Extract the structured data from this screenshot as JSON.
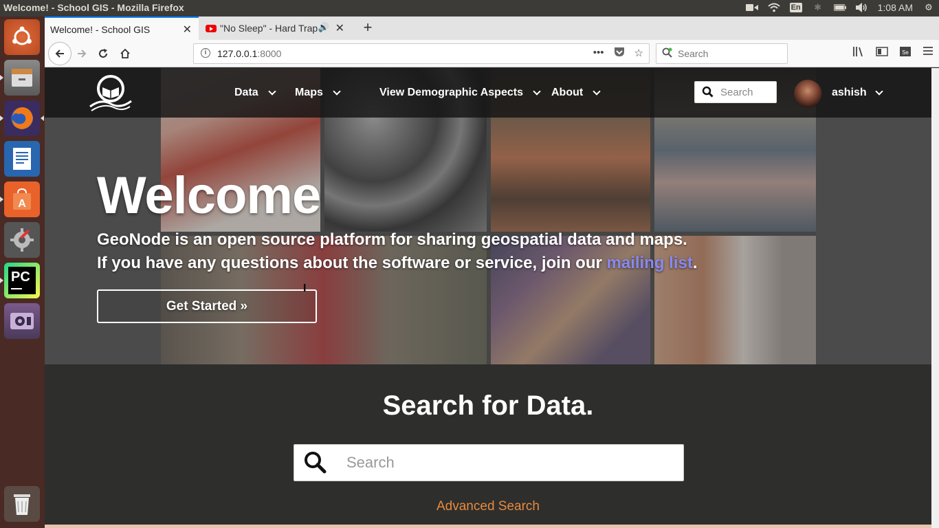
{
  "os": {
    "window_title": "Welcome! - School GIS - Mozilla Firefox",
    "clock": "1:08 AM",
    "keyboard_layout": "En"
  },
  "browser": {
    "tabs": [
      {
        "label": "Welcome! - School GIS",
        "active": true
      },
      {
        "label": "\"No Sleep\" - Hard Trap",
        "active": false
      }
    ],
    "url_host": "127.0.0.1",
    "url_port": ":8000",
    "search_placeholder": "Search"
  },
  "site": {
    "nav": {
      "data": "Data",
      "maps": "Maps",
      "demographic": "View Demographic Aspects",
      "about": "About"
    },
    "header_search_placeholder": "Search",
    "username": "ashish"
  },
  "hero": {
    "title": "Welcome",
    "line1": "GeoNode is an open source platform for sharing geospatial data and maps.",
    "line2_prefix": "If you have any questions about the software or service, join our ",
    "line2_link": "mailing list",
    "line2_suffix": ".",
    "cta": "Get Started »"
  },
  "search_section": {
    "title": "Search for Data.",
    "placeholder": "Search",
    "advanced": "Advanced Search"
  },
  "colors": {
    "link": "#8888ee",
    "advanced_link": "#e88a3c",
    "tab_accent": "#0a84ff",
    "launcher_bg": "#4a2a24"
  }
}
